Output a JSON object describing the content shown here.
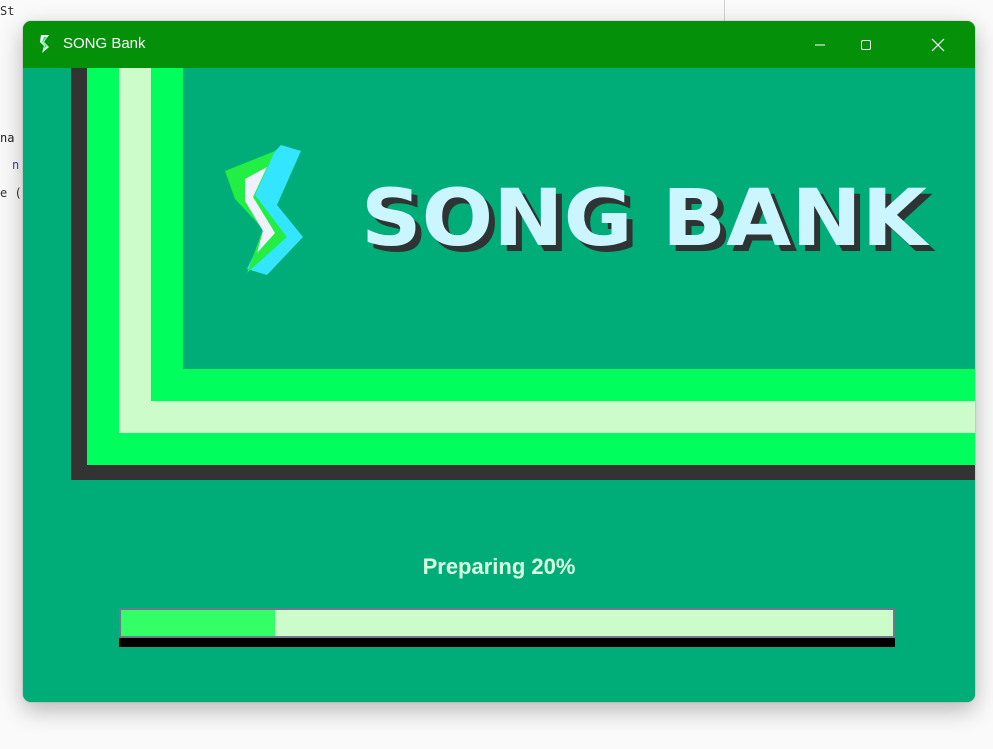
{
  "window": {
    "title": "SONG Bank",
    "controls": {
      "minimize": "minimize",
      "maximize": "maximize",
      "close": "close"
    }
  },
  "background_editor": {
    "line1": "St",
    "line2": "na",
    "line3": "n",
    "line4": "e ("
  },
  "splash": {
    "logo_text": "SONG BANK",
    "logo_icon": "lightning-s-icon",
    "status_label": "Preparing 20%",
    "progress": 0.2
  },
  "colors": {
    "titlebar": "#05900a",
    "background": "#00ad78",
    "stripe_bright": "#00ff5c",
    "stripe_light": "#ccfcca",
    "stripe_dark": "#333333",
    "logo_text": "#ccf6ff",
    "progress_fill": "#33ff66",
    "progress_track": "#ccfcca"
  }
}
